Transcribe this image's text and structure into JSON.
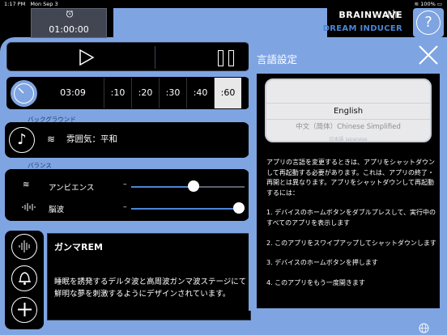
{
  "status_bar": {
    "time": "1:17 PM",
    "date": "Mon Sep 3",
    "battery": "100%"
  },
  "timer": {
    "value": "01:00:00"
  },
  "brand": {
    "line1": "BRAINWAVE",
    "line2": "DREAM INDUCER"
  },
  "help_button": {
    "label": "?"
  },
  "durations": {
    "elapsed": "03:09",
    "options": [
      ":10",
      ":20",
      ":30",
      ":40",
      ":60"
    ],
    "selected": ":60"
  },
  "background": {
    "section_label": "バックグラウンド",
    "value": "雰囲気：平和"
  },
  "balance": {
    "section_label": "バランス",
    "ambience_label": "アンビエンス",
    "ambience_level": 0.55,
    "brainwave_label": "脳波",
    "brainwave_level": 0.95,
    "minus": "–"
  },
  "session": {
    "title": "ガンマREM",
    "description": "睡眠を誘発するデルタ波と高周波ガンマ波ステージにて鮮明な夢を刺激するようにデザインされています。"
  },
  "language_modal": {
    "title": "言語設定",
    "options": [
      "English",
      "中文（简体）Chinese Simplified",
      "日本語 Japanese"
    ],
    "selected": "English",
    "info": [
      "アプリの言語を変更するときは、アプリをシャットダウンして再起動する必要があります。これは、アプリの終了・再開とは異なります。アプリをシャットダウンして再起動するには：",
      "1. デバイスのホームボタンをダブルプレスして、実行中のすべてのアプリを表示します",
      "2. このアプリをスワイプアップしてシャットダウンします",
      "3. デバイスのホームボタンを押します",
      "4. このアプリをもう一度開きます"
    ]
  },
  "colors": {
    "accent_blue": "#7fa4e2",
    "brand_blue": "#4a86d8",
    "slider_fill": "#4a86d8"
  }
}
